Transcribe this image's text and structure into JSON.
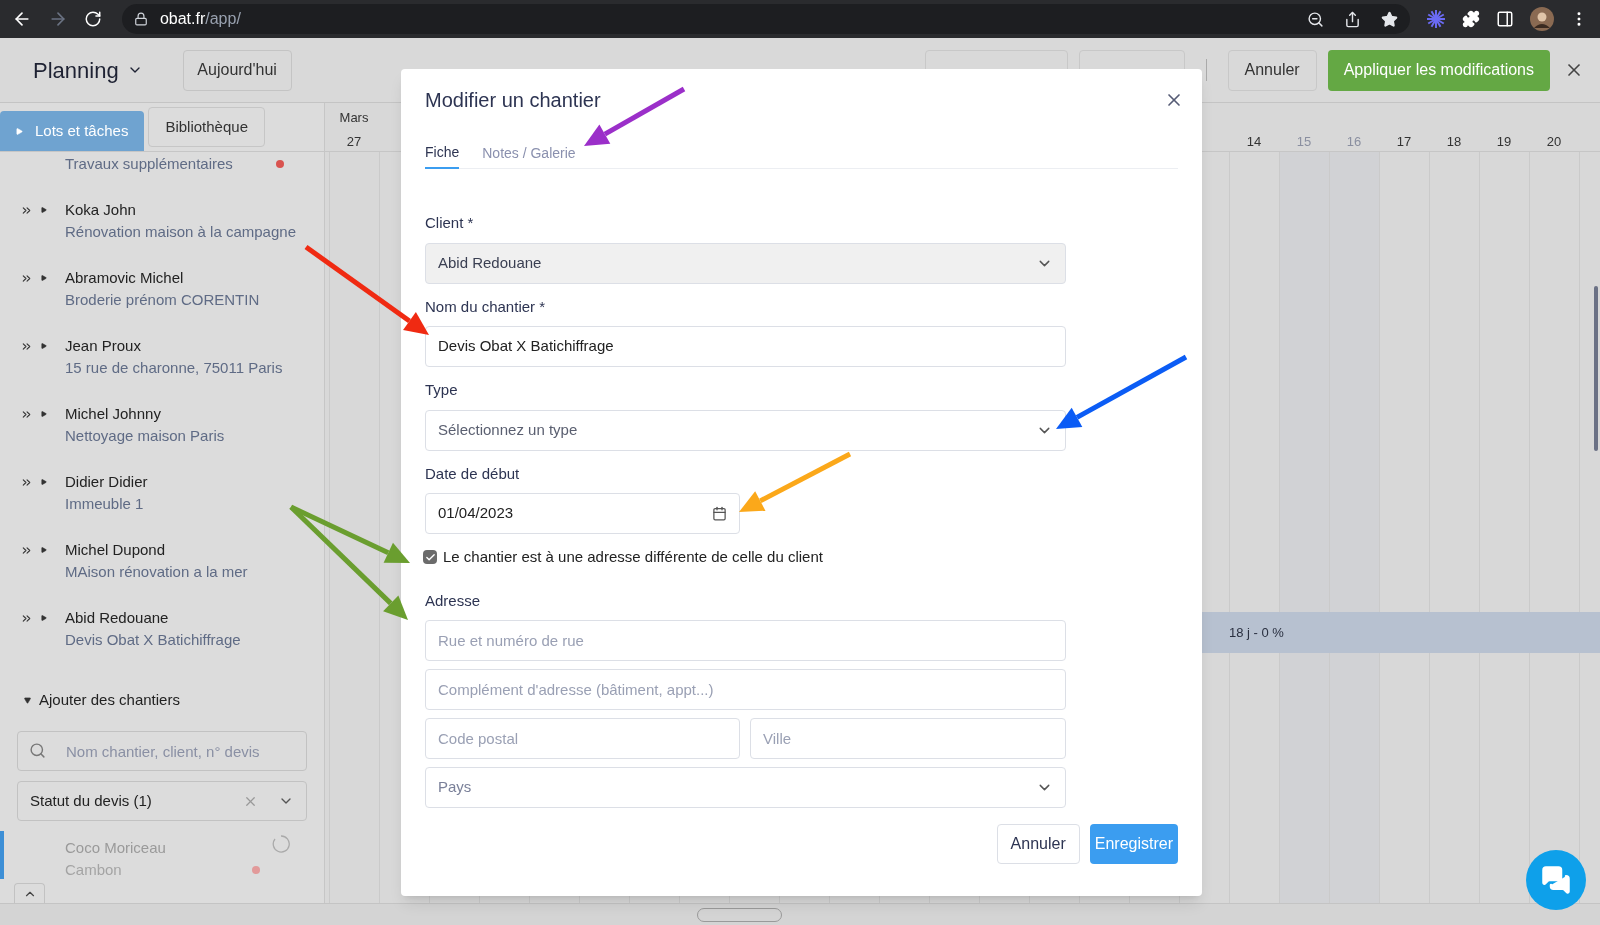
{
  "browser": {
    "url_host": "obat.fr",
    "url_path": "/app/"
  },
  "header": {
    "title": "Planning",
    "today_button": "Aujourd'hui",
    "buttons": [
      {
        "kind": "dropdown"
      },
      {
        "kind": "dropdown"
      },
      {
        "label": "Annuler",
        "kind": "plain"
      },
      {
        "label": "Appliquer les modifications",
        "kind": "primary"
      }
    ]
  },
  "sidebar": {
    "tabs": [
      {
        "label": "Lots et tâches",
        "selected": true
      },
      {
        "label": "Bibliothèque",
        "selected": false
      }
    ],
    "top_item": {
      "subtitle": "Travaux supplémentaires",
      "dot": true
    },
    "projects": [
      {
        "client": "Koka John",
        "site": "Rénovation maison à la campagne"
      },
      {
        "client": "Abramovic Michel",
        "site": "Broderie prénom CORENTIN"
      },
      {
        "client": "Jean Proux",
        "site": "15 rue de charonne, 75011 Paris"
      },
      {
        "client": "Michel Johnny",
        "site": "Nettoyage maison Paris"
      },
      {
        "client": "Didier Didier",
        "site": "Immeuble 1"
      },
      {
        "client": "Michel Dupond",
        "site": "MAison rénovation a la mer"
      },
      {
        "client": "Abid Redouane",
        "site": "Devis Obat X Batichiffrage"
      }
    ],
    "add_section": {
      "label": "Ajouter des chantiers",
      "expanded": true,
      "search_placeholder": "Nom chantier, client, n° devis",
      "status_filter": "Statut du devis (1)"
    },
    "pending": [
      {
        "client": "Coco Moriceau",
        "site": "Cambon",
        "dot": true
      }
    ]
  },
  "timeline": {
    "month": "Mars",
    "days_left": [
      {
        "label": "27",
        "weekend": false
      }
    ],
    "days_right": [
      {
        "label": "14",
        "weekend": false
      },
      {
        "label": "15",
        "weekend": true
      },
      {
        "label": "16",
        "weekend": true
      },
      {
        "label": "17",
        "weekend": false
      },
      {
        "label": "18",
        "weekend": false
      },
      {
        "label": "19",
        "weekend": false
      },
      {
        "label": "20",
        "weekend": false
      }
    ],
    "bar_label": "18 j - 0 %"
  },
  "modal": {
    "title": "Modifier un chantier",
    "tabs": [
      {
        "label": "Fiche",
        "selected": true
      },
      {
        "label": "Notes / Galerie",
        "selected": false
      }
    ],
    "fields": [
      {
        "kind": "select",
        "label": "Client *",
        "value": "Abid Redouane",
        "disabled": true
      },
      {
        "kind": "text",
        "label": "Nom du chantier *",
        "value": "Devis Obat X Batichiffrage"
      },
      {
        "kind": "select",
        "label": "Type",
        "placeholder": "Sélectionnez un type",
        "disabled": false
      },
      {
        "kind": "date",
        "label": "Date de début",
        "value": "01/04/2023"
      }
    ],
    "checkbox": {
      "label": "Le chantier est à une adresse différente de celle du client",
      "checked": true
    },
    "address": {
      "label": "Adresse",
      "street_placeholder": "Rue et numéro de rue",
      "complement_placeholder": "Complément d'adresse (bâtiment, appt...)",
      "postal_placeholder": "Code postal",
      "city_placeholder": "Ville",
      "country_placeholder": "Pays"
    },
    "buttons": [
      {
        "label": "Annuler",
        "kind": "secondary"
      },
      {
        "label": "Enregistrer",
        "kind": "primary"
      }
    ]
  },
  "annotations": [
    {
      "color": "#9b2fc9"
    },
    {
      "color": "#f02a12"
    },
    {
      "color": "#0b5cf5"
    },
    {
      "color": "#fba81a"
    },
    {
      "color": "#6a9e2f"
    },
    {
      "color": "#6a9e2f"
    }
  ]
}
